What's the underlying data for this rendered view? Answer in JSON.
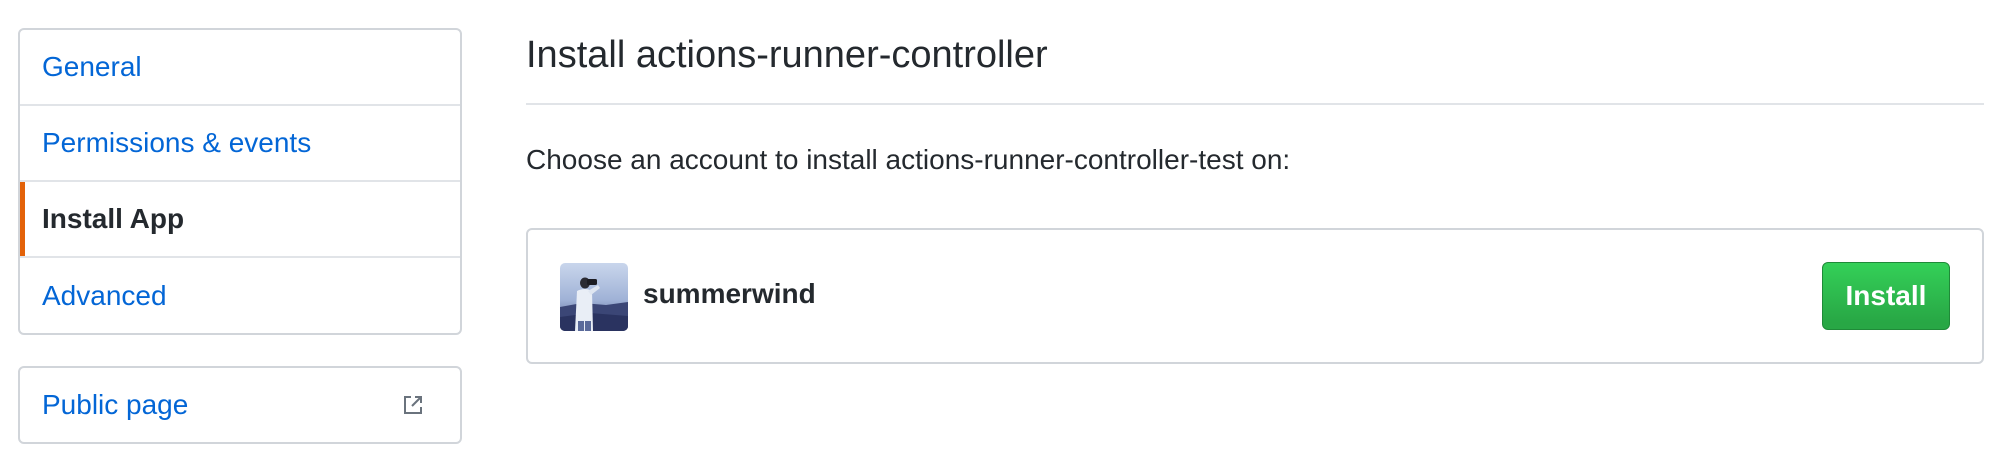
{
  "sidebar": {
    "items": [
      {
        "label": "General",
        "selected": false
      },
      {
        "label": "Permissions & events",
        "selected": false
      },
      {
        "label": "Install App",
        "selected": true
      },
      {
        "label": "Advanced",
        "selected": false
      }
    ],
    "public_page": {
      "label": "Public page",
      "icon": "external-link-icon"
    }
  },
  "main": {
    "title": "Install actions-runner-controller",
    "prompt": "Choose an account to install actions-runner-controller-test on:",
    "account": {
      "name": "summerwind",
      "avatar_icon": "user-avatar",
      "install_label": "Install"
    }
  },
  "colors": {
    "link": "#0366d6",
    "selected_accent": "#e36209",
    "install_button": "#28a745",
    "text": "#24292e",
    "border": "#d1d5da"
  }
}
